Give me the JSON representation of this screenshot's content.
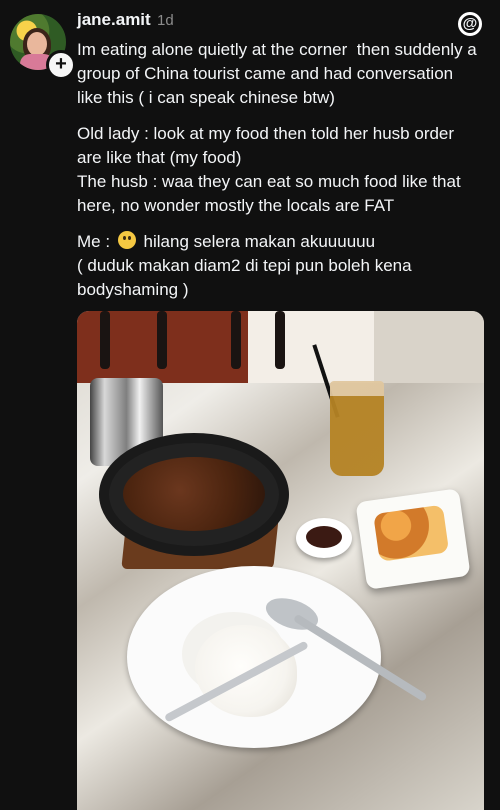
{
  "post": {
    "username": "jane.amit",
    "time": "1d",
    "line1": "Im eating alone quietly at the corner  then suddenly a group of China tourist came and had conversation like this ( i can speak chinese btw)",
    "line2": "Old lady : look at my food then told her husb order are like that (my food)\nThe husb : waa they can eat so much food like that here, no wonder mostly the locals are FAT",
    "line3_prefix": "Me : ",
    "line3_suffix": " hilang selera makan akuuuuuu\n( duduk makan diam2 di tepi pun boleh kena bodyshaming )",
    "emoji_name": "pleading-face-emoji",
    "icons": {
      "avatar": "profile-avatar",
      "add": "plus-icon",
      "threads": "threads-logo-icon"
    }
  }
}
